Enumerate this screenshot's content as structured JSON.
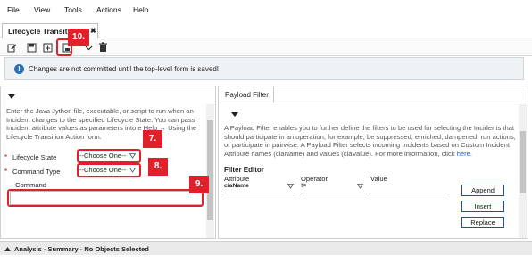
{
  "menu": {
    "items": [
      "File",
      "View",
      "Tools",
      "Actions",
      "Help"
    ]
  },
  "tab": {
    "title": "Lifecycle Transition",
    "close": "✖"
  },
  "notice": {
    "text": "Changes are not committed until the top-level form is saved!"
  },
  "left": {
    "description": "Enter the Java Jython file, executable, or script to run when an Incident changes to the specified Lifecycle State. You can pass Incident attribute values as parameters into e Help → Using the Lifecycle Transition Action form.",
    "lifecycle_state_label": "Lifecycle State",
    "lifecycle_state_value": "--Choose One--",
    "command_type_label": "Command Type",
    "command_type_value": "--Choose One--",
    "command_label": "Command",
    "required_marker": "*"
  },
  "right": {
    "tab_label": "Payload Filter",
    "description_prefix": "A Payload Filter enables you to further define the filters to be used for selecting the Incidents that should participate in an operation; for example, be suppressed, enriched, dampened, run actions, or participate in pairwise. A Payload Filter selects incoming Incidents based on Custom Incident Attribute names (ciaName) and values (ciaValue). For more information, click ",
    "description_link": "here.",
    "filter_editor_title": "Filter Editor",
    "attribute_label": "Attribute",
    "operator_label": "Operator",
    "value_label": "Value",
    "attribute_value": "ciaName",
    "operator_value": "!=",
    "buttons": {
      "append": "Append",
      "insert": "Insert",
      "replace": "Replace"
    }
  },
  "annotations": {
    "badge_10": "10.",
    "badge_7": "7.",
    "badge_8": "8.",
    "badge_9": "9."
  },
  "bottom": {
    "text": "Analysis - Summary - No Objects Selected"
  },
  "colors": {
    "annotation_red": "#e0202a",
    "link_blue": "#1a5fb4",
    "info_blue": "#2f6fb0"
  }
}
